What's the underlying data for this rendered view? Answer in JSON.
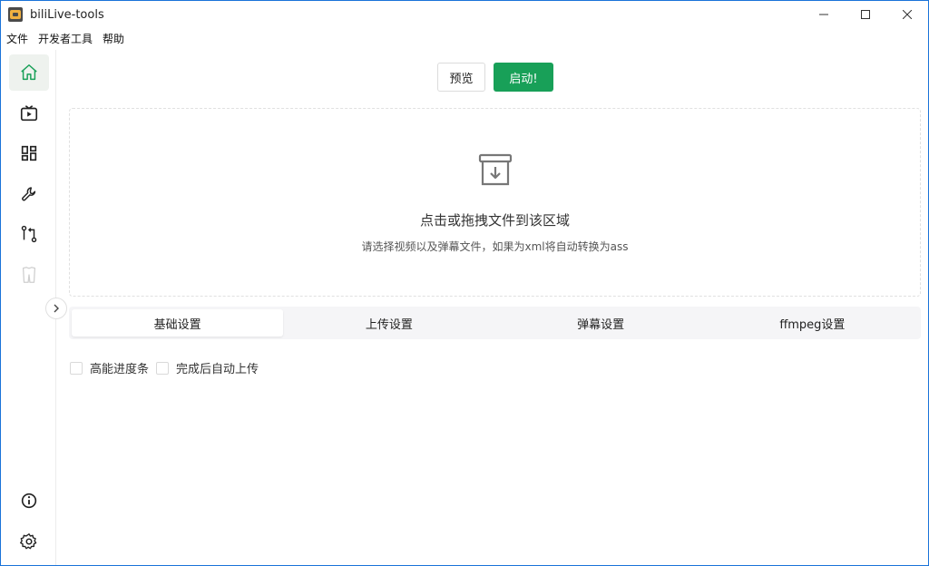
{
  "window": {
    "title": "biliLive-tools"
  },
  "menu": [
    "文件",
    "开发者工具",
    "帮助"
  ],
  "sidebar": {
    "items": [
      {
        "icon": "home-icon",
        "active": true
      },
      {
        "icon": "tv-icon",
        "active": false
      },
      {
        "icon": "dashboard-icon",
        "active": false
      },
      {
        "icon": "wrench-icon",
        "active": false
      },
      {
        "icon": "git-compare-icon",
        "active": false
      },
      {
        "icon": "cloth-icon",
        "active": false
      }
    ],
    "bottom": [
      {
        "icon": "info-icon"
      },
      {
        "icon": "gear-icon"
      }
    ]
  },
  "toolbar": {
    "preview_label": "预览",
    "start_label": "启动!"
  },
  "dropzone": {
    "title": "点击或拖拽文件到该区域",
    "subtitle": "请选择视频以及弹幕文件，如果为xml将自动转换为ass"
  },
  "tabs": [
    {
      "label": "基础设置",
      "active": true
    },
    {
      "label": "上传设置",
      "active": false
    },
    {
      "label": "弹幕设置",
      "active": false
    },
    {
      "label": "ffmpeg设置",
      "active": false
    }
  ],
  "options": [
    {
      "label": "高能进度条",
      "checked": false
    },
    {
      "label": "完成后自动上传",
      "checked": false
    }
  ],
  "colors": {
    "accent": "#18a058",
    "window_border": "#1a73d9"
  }
}
